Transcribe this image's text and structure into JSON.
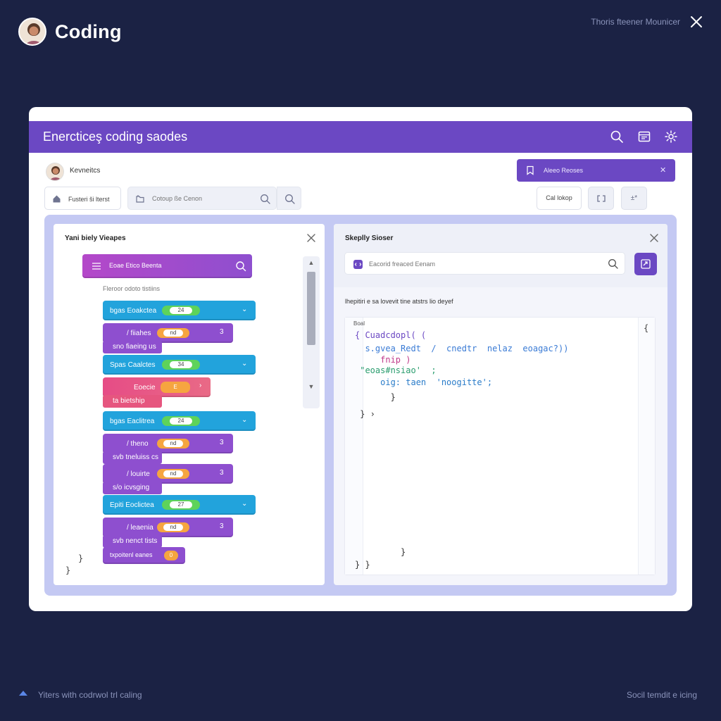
{
  "app": {
    "title": "Coding",
    "top_right_text": "Thoris fteener Mounicer"
  },
  "window": {
    "title": "Enercticeş coding saodes",
    "user_name": "Kevneitcs",
    "notice_text": "Aleeo Reoses",
    "home_label": "Fusteri ši lterst",
    "search_placeholder": "Cotoup ße Cenon",
    "tool_label": "Cal lokop",
    "tool3_glyph": "±*"
  },
  "left_panel": {
    "title": "Yani biely Vieapes",
    "top_block_label": "Eoae Etico Beenta",
    "caption": "Fleroor odoto tistiins",
    "blocks": [
      {
        "label": "bgas  Eoakctea",
        "value": "24"
      },
      {
        "label": "/ fiiahes",
        "value": "nd",
        "sub": "sno fiaeing us"
      },
      {
        "label": "Spas  Caalctes",
        "value": "34"
      },
      {
        "label": "Eoecie",
        "value": "E",
        "sub": "ta bietship"
      },
      {
        "label": "bgas  Eaclitrea",
        "value": "24"
      },
      {
        "label": "/ theno",
        "value": "nd",
        "sub": "svb tneluiss cs"
      },
      {
        "label": "/ louirte",
        "value": "nd",
        "sub": "s/o icvsging"
      },
      {
        "label": "Epiti  Eoclictea",
        "value": "27"
      },
      {
        "label": "/ leaenia",
        "value": "nd",
        "sub": "svb nenct tists"
      },
      {
        "label": "txpoitenl eanes",
        "value": "0"
      }
    ],
    "brace_1": "}",
    "brace_2": "}"
  },
  "right_panel": {
    "title": "Skeplly Sioser",
    "search_placeholder": "Eacorid freaced Eenam",
    "description": "lhepitiri  e sa lovevit  tine  atstrs  lio deyef",
    "code_label": "Boal",
    "scroll_glyph": "{",
    "code_lines": [
      {
        "text": "{ Cuadcdopl( (",
        "color": "#6b48c3"
      },
      {
        "text": "  s.gvea_Redt  /  cnedtr  nelaz  eoagac?))",
        "color": "#3a7bd5"
      },
      {
        "text": "     fnip )",
        "color": "#c0398a"
      },
      {
        "text": " \"eoas#nsiao'  ;",
        "color": "#2a9d6e"
      },
      {
        "text": "     oig: taen  'noogitte';",
        "color": "#2a7cc9"
      },
      {
        "text": "       }",
        "color": "#333333"
      },
      {
        "text": " } ›",
        "color": "#333333"
      },
      {
        "text": "         }",
        "color": "#333333"
      },
      {
        "text": "} }",
        "color": "#333333"
      }
    ]
  },
  "footer": {
    "left_text": "Yiters with codrwol trl caling",
    "right_text": "Socil temdit e icing"
  },
  "colors": {
    "background": "#1b2244",
    "header": "#6b48c3",
    "block_purple": "#8e4fcf",
    "block_blue": "#22a3dc",
    "block_pink": "#e64c86",
    "pill_green": "#5ed35a",
    "pill_orange": "#f6a540"
  }
}
